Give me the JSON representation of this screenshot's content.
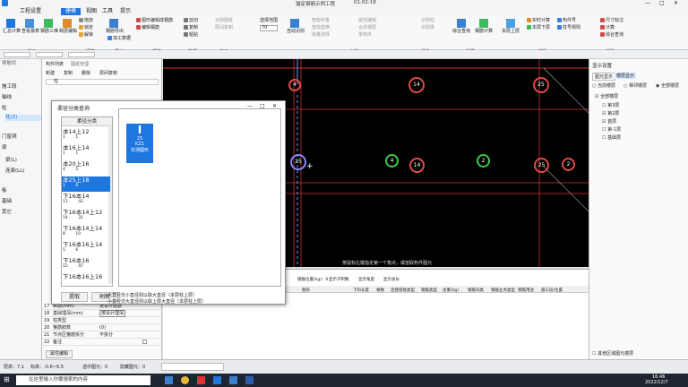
{
  "titlebar": {
    "file_title": "锚定钢筋示例工程",
    "time": "01:02:18"
  },
  "menu_tabs": [
    "工程设置",
    "建模",
    "视图",
    "工具",
    "提示"
  ],
  "ribbon": {
    "groups": [
      "通用",
      "钢筋",
      "钢筋",
      "导出",
      "数据",
      "施工",
      "合并",
      "清单",
      "提量",
      "编辑",
      "辅助"
    ],
    "items": [
      "汇总计算",
      "查看报表",
      "钢筋三维",
      "跨层编辑",
      "拖放",
      "锁定",
      "解锁",
      "钢筋导出",
      "加工数据",
      "图形编辑成钢筋",
      "编辑钢筋",
      "编辑工程",
      "剪切",
      "复制",
      "粘贴",
      "删除",
      "识别图纸",
      "层间复制",
      "选择范围",
      "自动识别",
      "智能布置",
      "查找替换",
      "批量选择",
      "属性编辑",
      "合并楼层",
      "单构件",
      "识别柱",
      "识别梁",
      "计算报表",
      "定额套取",
      "提示信息",
      "云检查",
      "实时计算",
      "本层上层",
      "本层下层",
      "构件号",
      "柱号规则",
      "尺寸标注",
      "计算",
      "综合查询",
      "钢筋计算"
    ],
    "dropdown": "70"
  },
  "nav": {
    "header": "导航栏",
    "items": [
      "施工段",
      "轴线",
      "柱",
      "柱(Z)",
      "门窗洞",
      "梁",
      "梁(L)",
      "连梁(LL)",
      "板",
      "基础",
      "其它"
    ]
  },
  "component": {
    "tabs": [
      "构件列表",
      "图纸管理"
    ],
    "toolbar": [
      "新建",
      "复制",
      "删除",
      "层间复制"
    ],
    "search": "柱",
    "selected": "柱(Z)",
    "sub": "约束边缘..."
  },
  "properties": [
    {
      "n": "17",
      "name": "纵筋(mm)",
      "val": "按设计配筋"
    },
    {
      "n": "18",
      "name": "基础埋深(mm)",
      "val": "按设计埋深"
    },
    {
      "n": "19",
      "name": "柱类型",
      "val": ""
    },
    {
      "n": "20",
      "name": "箍筋肢数",
      "val": "(0)"
    },
    {
      "n": "21",
      "name": "节点区箍筋拆分",
      "val": "不拆分"
    },
    {
      "n": "22",
      "name": "备注",
      "val": ""
    }
  ],
  "prop_footer": "属性编辑",
  "dialog": {
    "title": "柔径分类查询",
    "list_header": "柔径分类",
    "list": [
      {
        "main": "本14上12",
        "l": "1",
        "r": "1"
      },
      {
        "main": "本16上14",
        "l": "1",
        "r": "1"
      },
      {
        "main": "本20上16",
        "l": "4",
        "r": "5"
      },
      {
        "main": "本25上18",
        "l": "1",
        "r": "6"
      },
      {
        "main": "下16本14",
        "l": "11",
        "r": "42"
      },
      {
        "main": "下16本14上12",
        "l": "14",
        "r": "31"
      },
      {
        "main": "下16本14上14",
        "l": "8",
        "r": "10"
      },
      {
        "main": "下16本16上14",
        "l": "5",
        "r": "6"
      },
      {
        "main": "下16本16",
        "l": "12",
        "r": "47"
      },
      {
        "main": "下16本16上16",
        "l": "",
        "r": ""
      }
    ],
    "selected_index": 3,
    "card": {
      "badge": "25",
      "l1": "KZ1",
      "l2": "实测图形"
    },
    "note1": "大直径交小直径则以取大直径（本层柱上层）",
    "note2": "小直径交大直径则以取上层大直径（本层柱上层）",
    "btn_extract": "提取",
    "btn_refresh": "刷新"
  },
  "canvas": {
    "circles": [
      {
        "label": "4",
        "color": "#e04a4a"
      },
      {
        "label": "14",
        "color": "#e04a4a"
      },
      {
        "label": "25",
        "color": "#e04a4a"
      },
      {
        "label": "25",
        "color": "#8888ff"
      },
      {
        "label": "4",
        "color": "#3dcb4a"
      },
      {
        "label": "14",
        "color": "#e04a4a"
      },
      {
        "label": "2",
        "color": "#3dcb4a"
      },
      {
        "label": "25",
        "color": "#e04a4a"
      },
      {
        "label": "2",
        "color": "#e04a4a"
      }
    ],
    "hint": "按鼠标左键指定第一个角点，或拾取构件图元"
  },
  "table": {
    "toolbar": [
      "钢筋位置(kg)：0",
      "显示子积数",
      "显示角度",
      "显示总长"
    ],
    "headers": [
      "图形",
      "下料长度",
      "根数",
      "连接搭接类型",
      "钢筋类型",
      "总重(kg)",
      "钢筋归类",
      "钢筋业务类型",
      "钢筋用途",
      "施工段/位置"
    ]
  },
  "right": {
    "header": "显示设置",
    "tabs": [
      "图元显示",
      "楼层显示"
    ],
    "radios": [
      "当前楼层",
      "相邻楼层",
      "全部楼层"
    ],
    "tree_root": "全部楼层",
    "floors": [
      "第3层",
      "第2层",
      "首层",
      "第-1层",
      "基础层"
    ],
    "footer": "其他区域图元楼层"
  },
  "status": {
    "floor": "层高：7.1",
    "elev": "标高：-0.6~6.5",
    "selected": "选中图元：0",
    "hidden": "隐藏图元：0"
  },
  "taskbar": {
    "search": "在这里输入你要搜索的内容",
    "time": "16:46",
    "date": "2022/12/7"
  }
}
